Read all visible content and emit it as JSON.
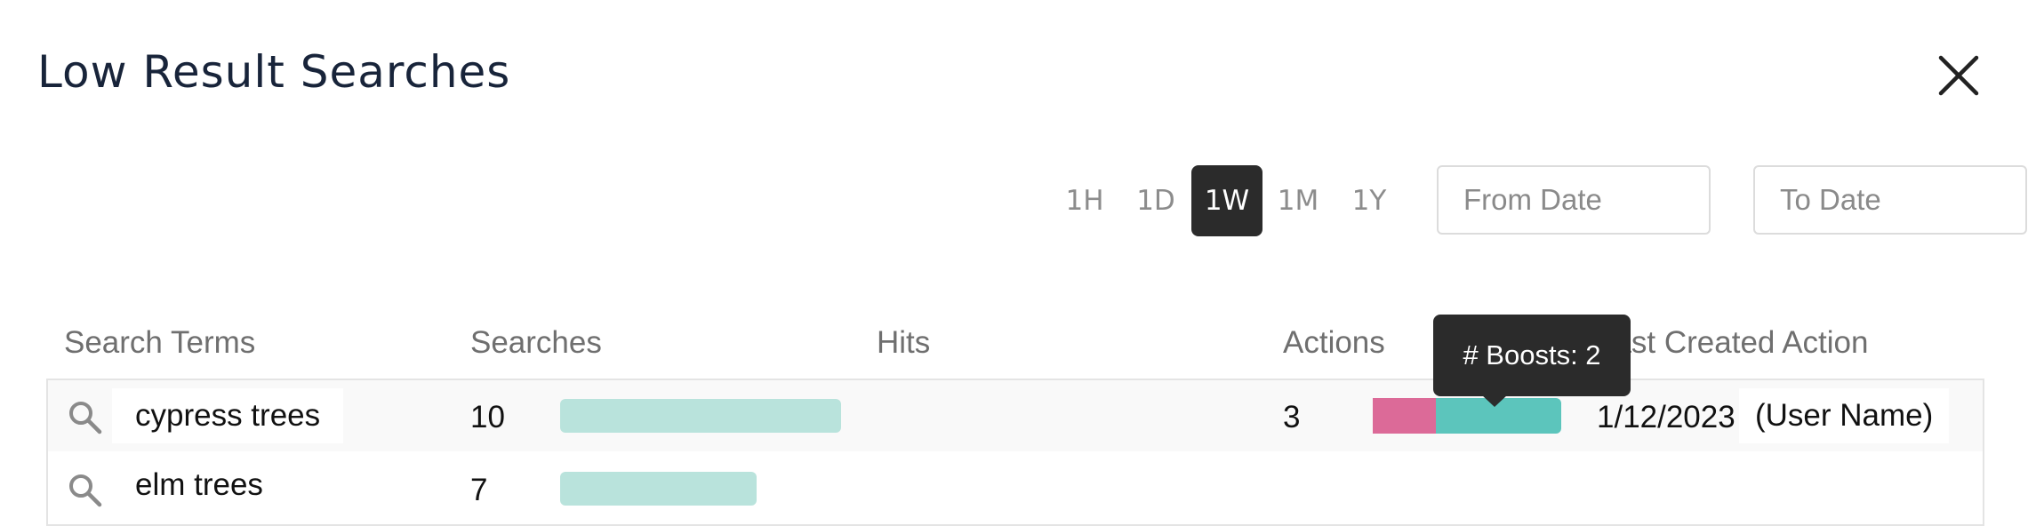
{
  "header": {
    "title": "Low Result Searches"
  },
  "range_buttons": [
    {
      "label": "1H",
      "active": false
    },
    {
      "label": "1D",
      "active": false
    },
    {
      "label": "1W",
      "active": true
    },
    {
      "label": "1M",
      "active": false
    },
    {
      "label": "1Y",
      "active": false
    }
  ],
  "filters": {
    "from_placeholder": "From Date",
    "to_placeholder": "To Date"
  },
  "table": {
    "columns": [
      "Search Terms",
      "Searches",
      "Hits",
      "Actions",
      "Last Created Action"
    ],
    "rows": [
      {
        "term": "cypress trees",
        "searches": "10",
        "searches_fraction": 1.0,
        "actions": "3",
        "action_breakdown": [
          {
            "type": "other",
            "count": 1
          },
          {
            "type": "boosts",
            "count": 2
          }
        ],
        "last_date": "1/12/2023",
        "last_user": "(User Name)"
      },
      {
        "term": "elm trees",
        "searches": "7",
        "searches_fraction": 0.7,
        "actions": "",
        "last_date": "",
        "last_user": ""
      }
    ]
  },
  "tooltip": {
    "text": "# Boosts: 2"
  },
  "icons": {
    "close": "close-icon",
    "search": "search-icon"
  },
  "colors": {
    "active_range": "#2b2b2b",
    "searches_bar": "#b9e3dc",
    "action_other": "#dc6a98",
    "action_boosts": "#5cc5bc"
  }
}
